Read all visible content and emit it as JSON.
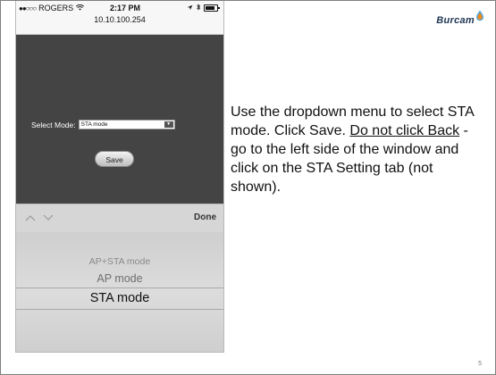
{
  "status_bar": {
    "signal": "●●○○○",
    "carrier": "ROGERS",
    "wifi_icon": "wifi-icon",
    "time": "2:17 PM",
    "url": "10.10.100.254",
    "location_icon": "location-arrow-icon",
    "bluetooth_icon": "bluetooth-icon",
    "battery_icon": "battery-icon"
  },
  "form": {
    "mode_label": "Select Mode:",
    "mode_value": "STA mode",
    "save_label": "Save"
  },
  "picker_toolbar": {
    "done_label": "Done"
  },
  "picker": {
    "options": [
      "AP+STA mode",
      "AP mode",
      "STA mode"
    ],
    "selected": "STA mode"
  },
  "logo": {
    "text": "Burcam"
  },
  "instructions": {
    "part1": "Use the dropdown menu to select STA mode. Click Save. ",
    "underlined": "Do not click Back",
    "part2": " - go to the left side of the window and click on the STA Setting tab (not shown)."
  },
  "page_number": "5",
  "colors": {
    "webview_bg": "#444444",
    "logo_blue": "#1d3552",
    "logo_orange": "#f28a1a",
    "logo_light_blue": "#4aa8e0"
  }
}
